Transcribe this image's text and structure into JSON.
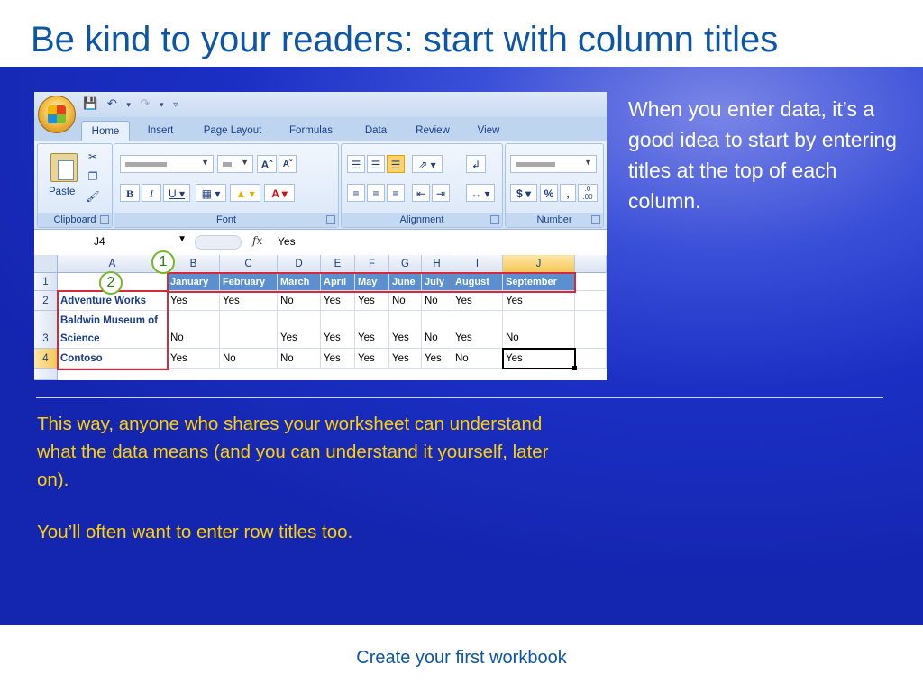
{
  "slide": {
    "title": "Be kind to your readers: start with column titles",
    "side_text": "When you enter data, it’s a good idea to start by entering titles at the top of each column.",
    "body_paragraph_1": "This way, anyone who shares your worksheet can understand what the data means (and you can understand it yourself, later on).",
    "body_paragraph_2": "You’ll often want to enter row titles too.",
    "footer": "Create your first workbook"
  },
  "excel": {
    "tabs": [
      "Home",
      "Insert",
      "Page Layout",
      "Formulas",
      "Data",
      "Review",
      "View"
    ],
    "active_tab": "Home",
    "groups": [
      "Clipboard",
      "Font",
      "Alignment",
      "Number"
    ],
    "paste_label": "Paste",
    "formula_bar": {
      "name_box": "J4",
      "fx_label": "fx",
      "value": "Yes"
    },
    "callouts": [
      "1",
      "2"
    ],
    "column_headers": [
      "A",
      "B",
      "C",
      "D",
      "E",
      "F",
      "G",
      "H",
      "I",
      "J"
    ],
    "row_headers": [
      "1",
      "2",
      "3",
      "4"
    ],
    "selected_column": "J",
    "selected_row": "4",
    "header_row": [
      "",
      "January",
      "February",
      "March",
      "April",
      "May",
      "June",
      "July",
      "August",
      "September"
    ],
    "rows": [
      [
        "Adventure Works",
        "Yes",
        "Yes",
        "No",
        "Yes",
        "Yes",
        "No",
        "No",
        "Yes",
        "Yes"
      ],
      [
        "Baldwin Museum of Science",
        "No",
        "",
        "Yes",
        "Yes",
        "Yes",
        "Yes",
        "No",
        "Yes",
        "No"
      ],
      [
        "Contoso",
        "Yes",
        "No",
        "No",
        "Yes",
        "Yes",
        "Yes",
        "Yes",
        "No",
        "Yes"
      ]
    ],
    "icons": {
      "office_button": "office-logo-icon",
      "save": "save-icon",
      "undo": "undo-icon",
      "redo": "redo-icon",
      "cut": "scissors-icon",
      "copy": "copy-icon",
      "format_painter": "brush-icon"
    }
  }
}
